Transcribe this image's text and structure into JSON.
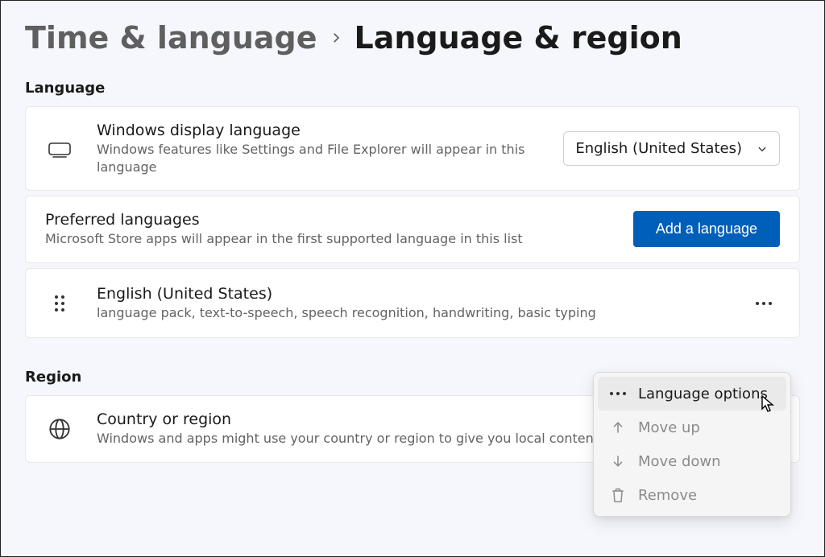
{
  "breadcrumb": {
    "prev": "Time & language",
    "current": "Language & region"
  },
  "sections": {
    "language": "Language",
    "region": "Region"
  },
  "display_lang": {
    "title": "Windows display language",
    "sub": "Windows features like Settings and File Explorer will appear in this language",
    "value": "English (United States)"
  },
  "preferred": {
    "title": "Preferred languages",
    "sub": "Microsoft Store apps will appear in the first supported language in this list",
    "add": "Add a language"
  },
  "lang_item": {
    "title": "English (United States)",
    "sub": "language pack, text-to-speech, speech recognition, handwriting, basic typing"
  },
  "country": {
    "title": "Country or region",
    "sub": "Windows and apps might use your country or region to give you local content"
  },
  "menu": {
    "language_options": "Language options",
    "move_up": "Move up",
    "move_down": "Move down",
    "remove": "Remove"
  }
}
